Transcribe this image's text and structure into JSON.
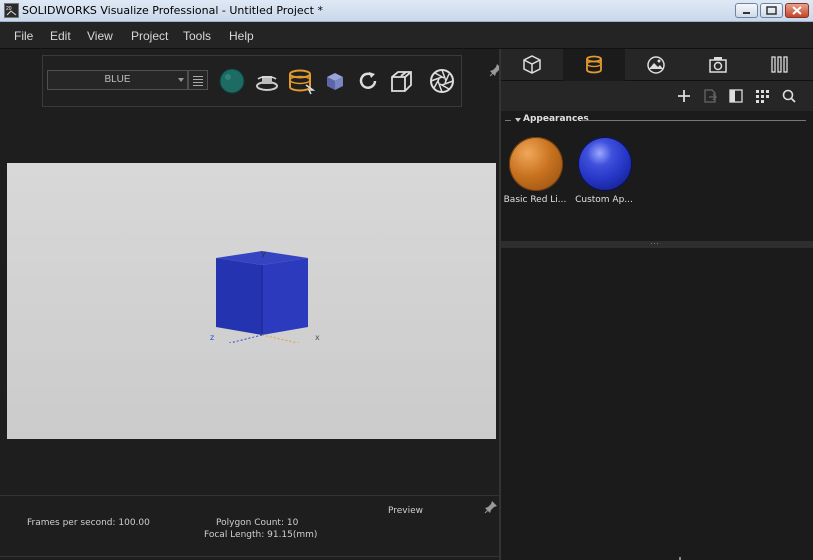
{
  "window": {
    "title": "SOLIDWORKS Visualize Professional - Untitled Project *",
    "app_icon": "solidworks-visualize-icon"
  },
  "menu": {
    "items": [
      "File",
      "Edit",
      "View",
      "Project",
      "Tools",
      "Help"
    ]
  },
  "toolbar": {
    "environment_selected": "BLUE",
    "icons": [
      "environment-sphere-icon",
      "turntable-icon",
      "appearance-select-icon",
      "object-select-icon",
      "refresh-icon",
      "camera-view-icon",
      "aperture-icon"
    ]
  },
  "viewport": {
    "background": "#d2d2d2",
    "model_color": "#2433b0",
    "axes": {
      "y": "y",
      "x": "x",
      "z": "z"
    }
  },
  "status": {
    "preview_label": "Preview",
    "fps": "Frames per second: 100.00",
    "polygon_count": "Polygon Count: 10",
    "focal_length": "Focal Length: 91.15(mm)"
  },
  "right_panel": {
    "tabs": [
      "models-tab",
      "appearances-tab",
      "scenes-tab",
      "cameras-tab",
      "libraries-tab"
    ],
    "active_tab": "appearances-tab",
    "actions": [
      "add-icon",
      "export-icon",
      "panel-icon",
      "grid-view-icon",
      "search-icon"
    ],
    "section_title": "Appearances",
    "appearances": [
      {
        "name": "Basic Red Li...",
        "color": "#c8721f"
      },
      {
        "name": "Custom Ap...",
        "color": "#2535c4"
      }
    ]
  }
}
